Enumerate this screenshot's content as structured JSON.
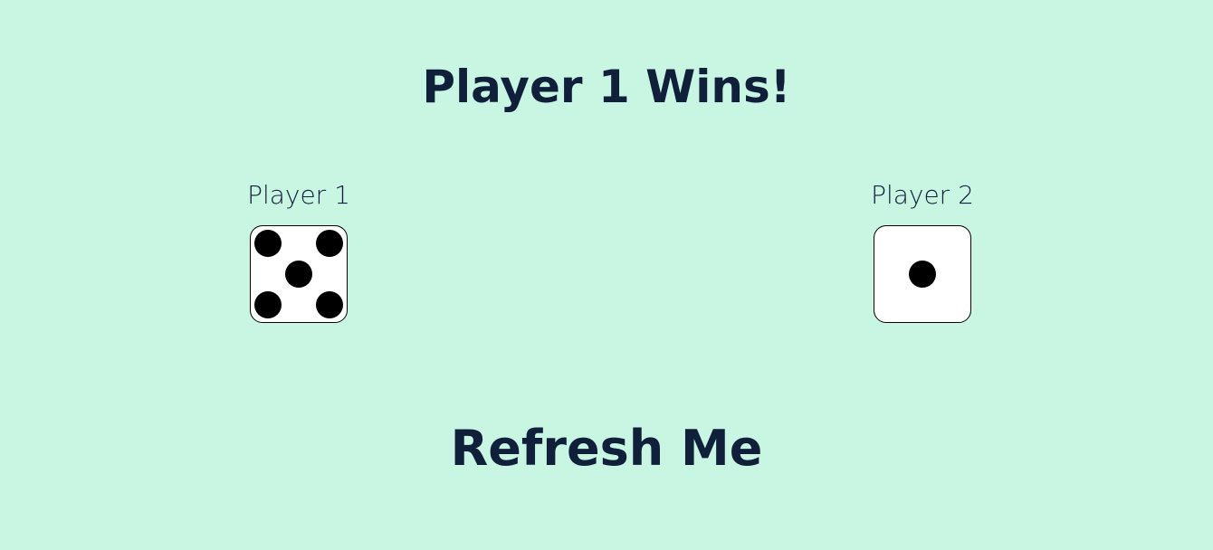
{
  "result": {
    "title": "Player 1 Wins!"
  },
  "players": [
    {
      "label": "Player 1",
      "die_value": 5
    },
    {
      "label": "Player 2",
      "die_value": 1
    }
  ],
  "action": {
    "refresh_label": "Refresh Me"
  },
  "colors": {
    "background": "#c9f5e3",
    "text": "#10203a",
    "die_face": "#ffffff",
    "pip": "#000000"
  }
}
